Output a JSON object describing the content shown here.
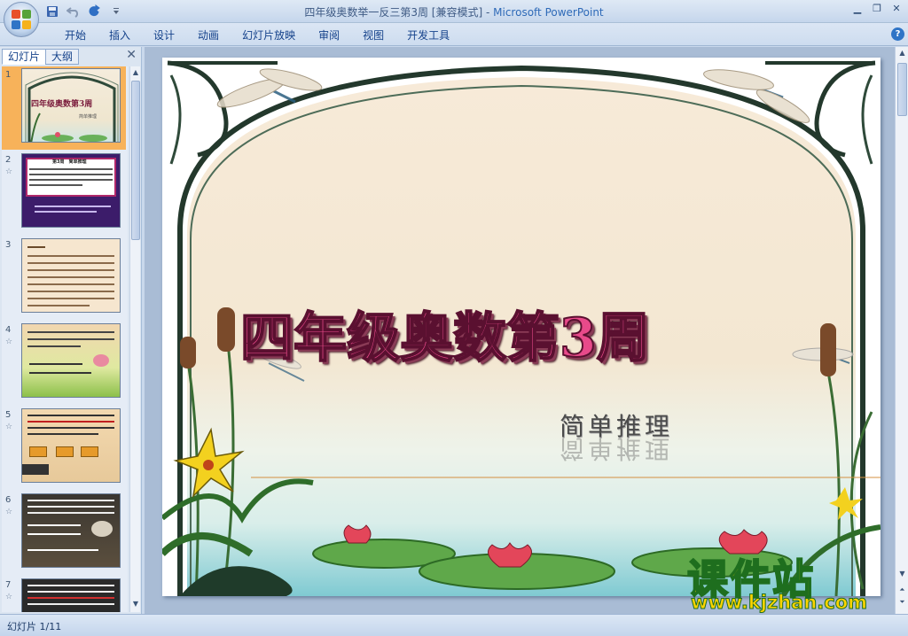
{
  "window": {
    "title": "四年级奥数举一反三第3周 [兼容模式]",
    "separator": " - ",
    "app_name": "Microsoft PowerPoint"
  },
  "ribbon": {
    "tabs": [
      "开始",
      "插入",
      "设计",
      "动画",
      "幻灯片放映",
      "审阅",
      "视图",
      "开发工具"
    ]
  },
  "pane": {
    "tab_slides": "幻灯片",
    "tab_outline": "大纲",
    "slides": [
      {
        "num": "1"
      },
      {
        "num": "2"
      },
      {
        "num": "3"
      },
      {
        "num": "4"
      },
      {
        "num": "5"
      },
      {
        "num": "6"
      },
      {
        "num": "7"
      }
    ],
    "thumb1_title": "四年级奥数第3周",
    "thumb1_sub": "简单推理",
    "thumb2_title": "第3周　简单推理"
  },
  "slide": {
    "title": "四年级奥数第3周",
    "subtitle": "简单推理"
  },
  "watermark": {
    "brand": "课件站",
    "url": "www.kjzhan.com"
  },
  "status": {
    "slide_indicator": "幻灯片 1/11"
  },
  "colors": {
    "title_pink": "#e84a8a",
    "selection_orange": "#f7b25a",
    "watermark_yellow": "#ffd400"
  }
}
